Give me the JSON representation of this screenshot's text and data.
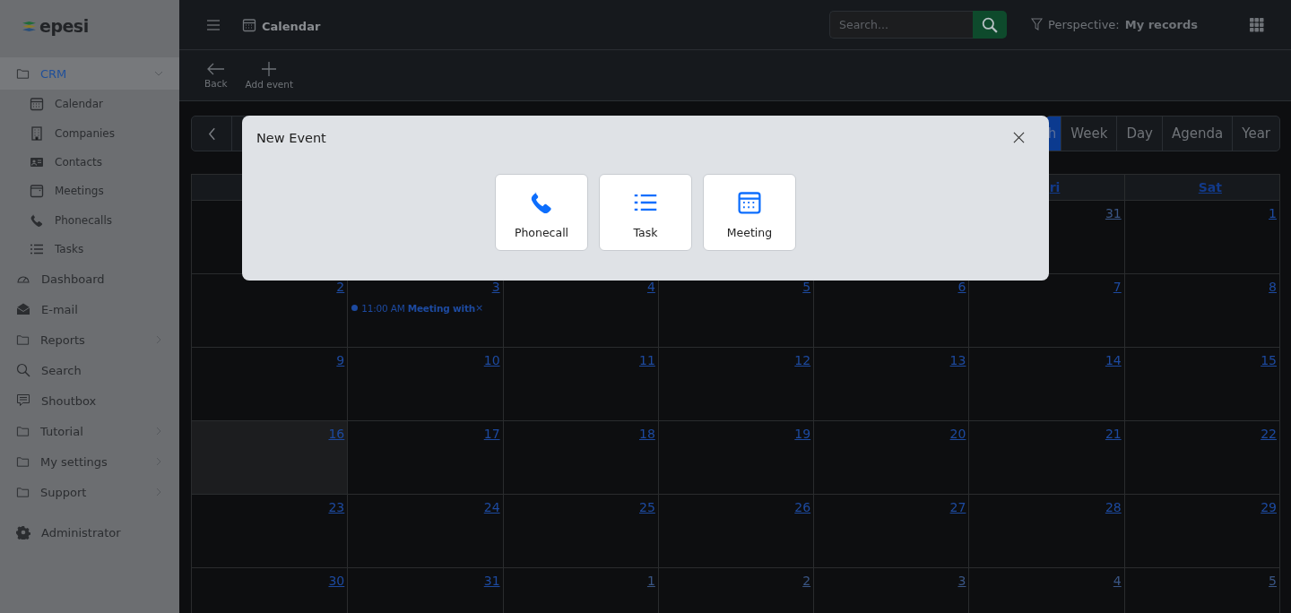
{
  "sidebar": {
    "logo": "epesi",
    "items": [
      {
        "label": "CRM",
        "selected": true,
        "expanded": true,
        "children": [
          {
            "label": "Calendar"
          },
          {
            "label": "Companies"
          },
          {
            "label": "Contacts"
          },
          {
            "label": "Meetings"
          },
          {
            "label": "Phonecalls"
          },
          {
            "label": "Tasks"
          }
        ]
      },
      {
        "label": "Dashboard",
        "selected": false
      },
      {
        "label": "E-mail",
        "selected": false
      },
      {
        "label": "Reports",
        "selected": false,
        "expanded": false
      },
      {
        "label": "Search",
        "selected": false
      },
      {
        "label": "Shoutbox",
        "selected": false
      },
      {
        "label": "Tutorial",
        "selected": false,
        "expanded": false
      },
      {
        "label": "My settings",
        "selected": false,
        "expanded": false
      },
      {
        "label": "Support",
        "selected": false,
        "expanded": false
      }
    ],
    "footer_item": {
      "label": "Administrator"
    }
  },
  "topbar": {
    "title": "Calendar",
    "search": {
      "placeholder": "Search..."
    },
    "perspective_label": "Perspective:",
    "perspective_value": "My records"
  },
  "toolbar": [
    {
      "label": "Back"
    },
    {
      "label": "Add event"
    }
  ],
  "calendar": {
    "views": [
      {
        "label": "h",
        "selected": true
      },
      {
        "label": "Week",
        "selected": false
      },
      {
        "label": "Day",
        "selected": false
      },
      {
        "label": "Agenda",
        "selected": false
      },
      {
        "label": "Year",
        "selected": false
      }
    ],
    "headers": [
      {
        "label": "ri"
      },
      {
        "label": "Sat"
      }
    ],
    "weeks": [
      {
        "cells": [
          {
            "day": "31",
            "muted": true
          },
          {
            "day": "1",
            "muted": false
          }
        ]
      },
      {
        "cells": [
          {
            "day": "2",
            "muted": false
          },
          {
            "day": "3",
            "muted": false,
            "events": [
              {
                "time": "11:00 AM",
                "title": "Meeting with",
                "remove": "×"
              }
            ]
          },
          {
            "day": "4",
            "muted": false
          },
          {
            "day": "5",
            "muted": false
          },
          {
            "day": "6",
            "muted": false
          },
          {
            "day": "7",
            "muted": false
          },
          {
            "day": "8",
            "muted": false
          }
        ]
      },
      {
        "cells": [
          {
            "day": "9",
            "muted": false
          },
          {
            "day": "10",
            "muted": false
          },
          {
            "day": "11",
            "muted": false
          },
          {
            "day": "12",
            "muted": false
          },
          {
            "day": "13",
            "muted": false
          },
          {
            "day": "14",
            "muted": false
          },
          {
            "day": "15",
            "muted": false
          }
        ]
      },
      {
        "cells": [
          {
            "day": "16",
            "muted": false,
            "today": true
          },
          {
            "day": "17",
            "muted": false
          },
          {
            "day": "18",
            "muted": false
          },
          {
            "day": "19",
            "muted": false
          },
          {
            "day": "20",
            "muted": false
          },
          {
            "day": "21",
            "muted": false
          },
          {
            "day": "22",
            "muted": false
          }
        ]
      },
      {
        "cells": [
          {
            "day": "23",
            "muted": false
          },
          {
            "day": "24",
            "muted": false
          },
          {
            "day": "25",
            "muted": false
          },
          {
            "day": "26",
            "muted": false
          },
          {
            "day": "27",
            "muted": false
          },
          {
            "day": "28",
            "muted": false
          },
          {
            "day": "29",
            "muted": false
          }
        ]
      },
      {
        "cells": [
          {
            "day": "30",
            "muted": false
          },
          {
            "day": "31",
            "muted": false
          },
          {
            "day": "1",
            "muted": true
          },
          {
            "day": "2",
            "muted": true
          },
          {
            "day": "3",
            "muted": true
          },
          {
            "day": "4",
            "muted": true
          },
          {
            "day": "5",
            "muted": true
          }
        ]
      }
    ]
  },
  "modal": {
    "title": "New Event",
    "options": [
      {
        "label": "Phonecall"
      },
      {
        "label": "Task"
      },
      {
        "label": "Meeting"
      }
    ]
  }
}
